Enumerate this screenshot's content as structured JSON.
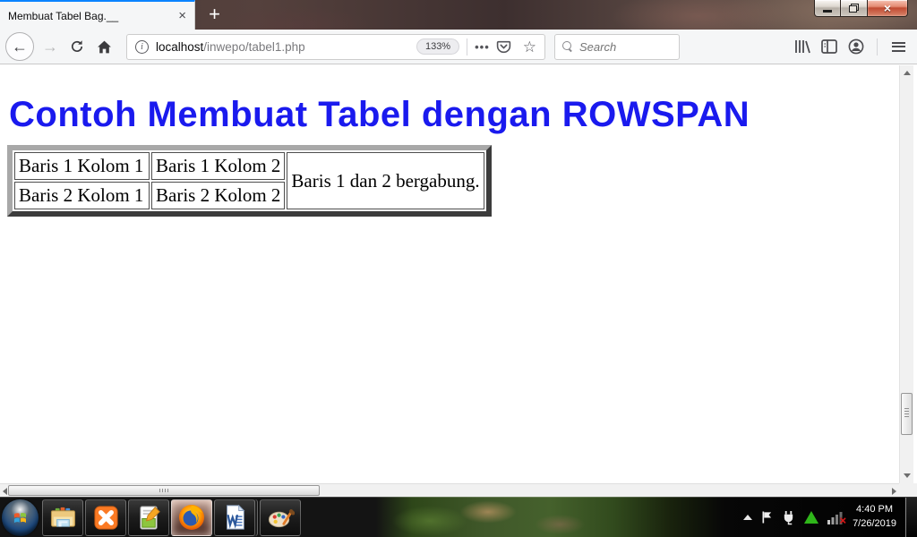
{
  "browser": {
    "tab_title": "Membuat Tabel Bag.__",
    "url_host": "localhost",
    "url_path": "/inwepo/tabel1.php",
    "zoom_badge": "133%",
    "search_placeholder": "Search"
  },
  "page": {
    "heading": "Contoh Membuat Tabel dengan ROWSPAN",
    "table": {
      "rows": [
        [
          "Baris 1 Kolom 1",
          "Baris 1 Kolom 2"
        ],
        [
          "Baris 2 Kolom 1",
          "Baris 2 Kolom 2"
        ]
      ],
      "rowspan_cell": "Baris 1 dan 2 bergabung."
    }
  },
  "taskbar": {
    "time": "4:40 PM",
    "date": "7/26/2019"
  },
  "icons": {
    "close_x": "×",
    "new_tab": "+",
    "back_arrow": "←",
    "forward_arrow": "→",
    "page_actions_dots": "•••",
    "bookmark_star": "☆",
    "info_i": "i"
  },
  "colors": {
    "active_tab_line": "#0a84ff",
    "heading_blue": "#1a1aee",
    "close_button_red": "#c14b32",
    "xampp_orange": "#fb7a24"
  }
}
